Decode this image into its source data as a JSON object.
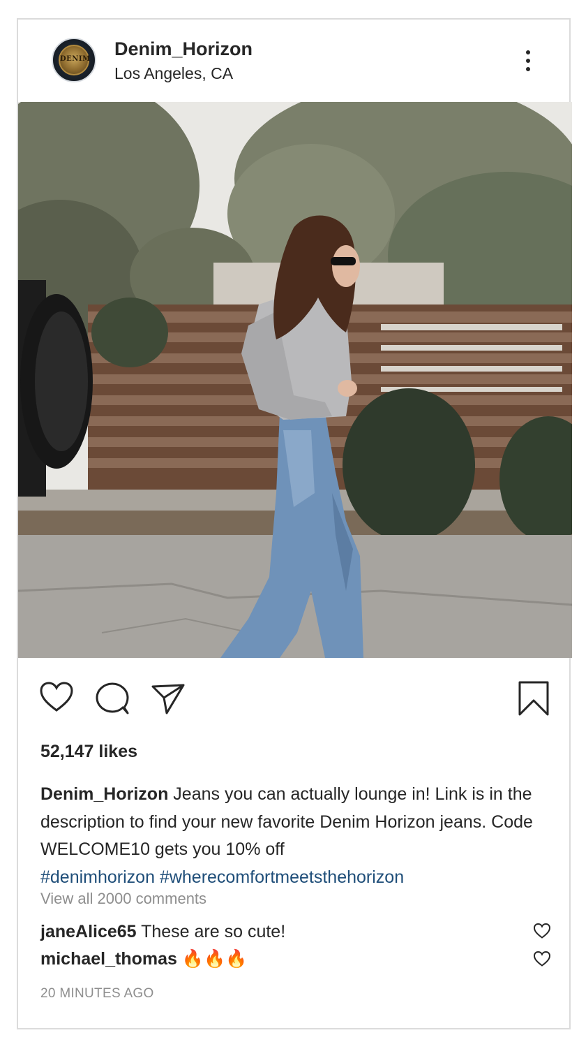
{
  "post": {
    "username": "Denim_Horizon",
    "location": "Los Angeles, CA",
    "avatar_text": "DENIM",
    "likes": "52,147 likes",
    "caption_user": "Denim_Horizon",
    "caption_text": " Jeans you can actually lounge in! Link is in the description to find your new favorite Denim Horizon jeans. Code WELCOME10 gets you 10% off",
    "hashtags": "#denimhorizon #wherecomfortmeetsthehorizon",
    "view_all": "View all 2000 comments",
    "comments": [
      {
        "user": "janeAlice65",
        "text": " These are so cute!"
      },
      {
        "user": "michael_thomas",
        "text": " 🔥🔥🔥"
      }
    ],
    "timestamp": "20 MINUTES AGO"
  },
  "icons": {
    "like": "heart-icon",
    "comment": "comment-icon",
    "share": "send-icon",
    "save": "bookmark-icon",
    "more": "more-options-icon",
    "comment_like": "heart-icon"
  },
  "colors": {
    "text": "#262626",
    "muted": "#8e8e8e",
    "hashtag": "#1f4e79",
    "border": "#dbdbdb"
  }
}
